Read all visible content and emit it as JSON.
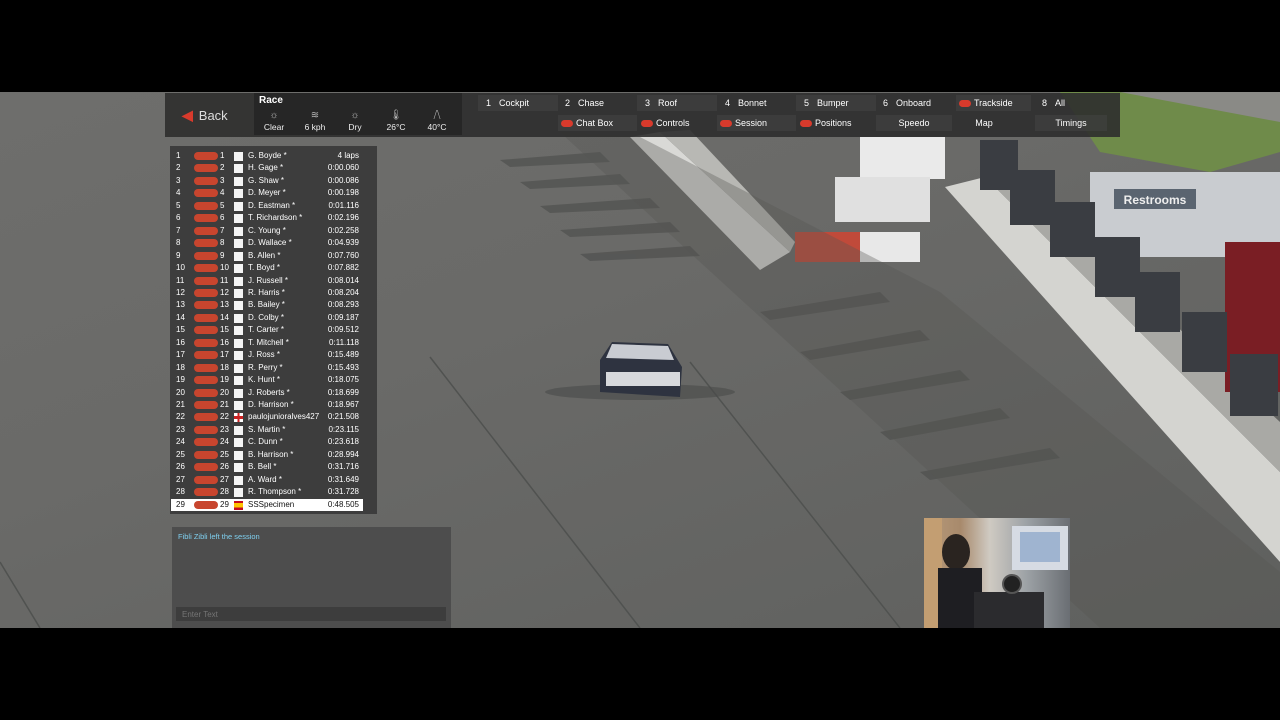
{
  "hud": {
    "back_label": "Back",
    "session_title": "Race",
    "weather": [
      {
        "icon": "sun-icon",
        "label": "Clear"
      },
      {
        "icon": "wind-icon",
        "label": "6 kph"
      },
      {
        "icon": "sun-icon",
        "label": "Dry"
      },
      {
        "icon": "thermometer-icon",
        "label": "26°C"
      },
      {
        "icon": "road-icon",
        "label": "40°C"
      }
    ],
    "camera_row1": [
      {
        "num": "1",
        "label": "Cockpit"
      },
      {
        "num": "2",
        "label": "Chase"
      },
      {
        "num": "3",
        "label": "Roof"
      },
      {
        "num": "4",
        "label": "Bonnet"
      },
      {
        "num": "5",
        "label": "Bumper"
      },
      {
        "num": "6",
        "label": "Onboard"
      },
      {
        "num": "",
        "label": "Trackside"
      },
      {
        "num": "8",
        "label": "All"
      }
    ],
    "camera_row2": [
      {
        "label": "Chat Box"
      },
      {
        "label": "Controls"
      },
      {
        "label": "Session"
      },
      {
        "label": "Positions"
      },
      {
        "label": "Speedo"
      },
      {
        "label": "Map"
      },
      {
        "label": "Timings"
      }
    ]
  },
  "standings": [
    {
      "pos": "1",
      "grid": "1",
      "name": "G. Boyde *",
      "gap": "4 laps"
    },
    {
      "pos": "2",
      "grid": "2",
      "name": "H. Gage *",
      "gap": "0:00.060"
    },
    {
      "pos": "3",
      "grid": "3",
      "name": "G. Shaw *",
      "gap": "0:00.086"
    },
    {
      "pos": "4",
      "grid": "4",
      "name": "D. Meyer *",
      "gap": "0:00.198"
    },
    {
      "pos": "5",
      "grid": "5",
      "name": "D. Eastman *",
      "gap": "0:01.116"
    },
    {
      "pos": "6",
      "grid": "6",
      "name": "T. Richardson *",
      "gap": "0:02.196"
    },
    {
      "pos": "7",
      "grid": "7",
      "name": "C. Young *",
      "gap": "0:02.258"
    },
    {
      "pos": "8",
      "grid": "8",
      "name": "D. Wallace *",
      "gap": "0:04.939"
    },
    {
      "pos": "9",
      "grid": "9",
      "name": "B. Allen *",
      "gap": "0:07.760"
    },
    {
      "pos": "10",
      "grid": "10",
      "name": "T. Boyd *",
      "gap": "0:07.882"
    },
    {
      "pos": "11",
      "grid": "11",
      "name": "J. Russell *",
      "gap": "0:08.014"
    },
    {
      "pos": "12",
      "grid": "12",
      "name": "R. Harris *",
      "gap": "0:08.204"
    },
    {
      "pos": "13",
      "grid": "13",
      "name": "B. Bailey *",
      "gap": "0:08.293"
    },
    {
      "pos": "14",
      "grid": "14",
      "name": "D. Colby *",
      "gap": "0:09.187"
    },
    {
      "pos": "15",
      "grid": "15",
      "name": "T. Carter *",
      "gap": "0:09.512"
    },
    {
      "pos": "16",
      "grid": "16",
      "name": "T. Mitchell *",
      "gap": "0:11.118"
    },
    {
      "pos": "17",
      "grid": "17",
      "name": "J. Ross *",
      "gap": "0:15.489"
    },
    {
      "pos": "18",
      "grid": "18",
      "name": "R. Perry *",
      "gap": "0:15.493"
    },
    {
      "pos": "19",
      "grid": "19",
      "name": "K. Hunt *",
      "gap": "0:18.075"
    },
    {
      "pos": "20",
      "grid": "20",
      "name": "J. Roberts *",
      "gap": "0:18.699"
    },
    {
      "pos": "21",
      "grid": "21",
      "name": "D. Harrison *",
      "gap": "0:18.967"
    },
    {
      "pos": "22",
      "grid": "22",
      "name": "paulojunioralves427",
      "gap": "0:21.508",
      "flag": "uk"
    },
    {
      "pos": "23",
      "grid": "23",
      "name": "S. Martin *",
      "gap": "0:23.115"
    },
    {
      "pos": "24",
      "grid": "24",
      "name": "C. Dunn *",
      "gap": "0:23.618"
    },
    {
      "pos": "25",
      "grid": "25",
      "name": "B. Harrison *",
      "gap": "0:28.994"
    },
    {
      "pos": "26",
      "grid": "26",
      "name": "B. Bell *",
      "gap": "0:31.716"
    },
    {
      "pos": "27",
      "grid": "27",
      "name": "A. Ward *",
      "gap": "0:31.649"
    },
    {
      "pos": "28",
      "grid": "28",
      "name": "R. Thompson *",
      "gap": "0:31.728"
    },
    {
      "pos": "29",
      "grid": "29",
      "name": "SSSpecimen",
      "gap": "0:48.505",
      "flag": "es",
      "highlight": true
    }
  ],
  "chat": {
    "message": "Fibli Zibli left the session",
    "input_placeholder": "Enter Text"
  },
  "scene": {
    "sign_text": "Restrooms"
  },
  "colors": {
    "accent_red": "#d83a2c",
    "chat_text": "#7fd0f0",
    "panel_bg": "#2d2d2d"
  }
}
